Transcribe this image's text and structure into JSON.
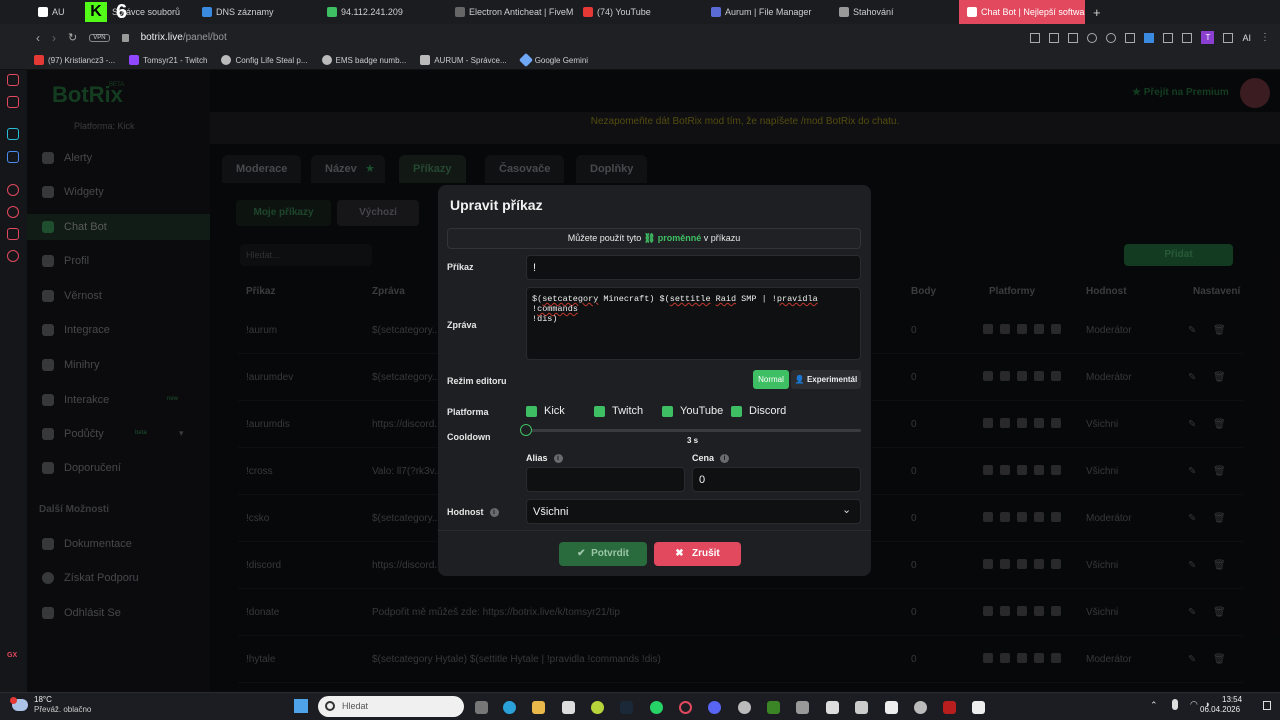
{
  "browser": {
    "tabs": [
      {
        "label": "AU",
        "color": "#e2495e"
      },
      {
        "label": "Správce souborů",
        "color": "#888"
      },
      {
        "label": "DNS záznamy",
        "color": "#3a8be0"
      },
      {
        "label": "94.112.241.209",
        "color": "#3fbf63"
      },
      {
        "label": "Electron Anticheat | FiveM",
        "color": "#666"
      },
      {
        "label": "(74) YouTube",
        "color": "#e53935"
      },
      {
        "label": "Aurum | File Manager",
        "color": "#5b6bd6"
      },
      {
        "label": "Stahování",
        "color": "#999"
      },
      {
        "label": "Chat Bot | Nejlepší software",
        "color": "#fff"
      }
    ],
    "new_tab": "+",
    "vpn": "VPN",
    "url_host": "botrix.live",
    "url_path": "/panel/bot",
    "ai_label": "AI",
    "profile_initial": "T",
    "bookmarks": [
      "(97) Kristiancz3 -...",
      "Tomsyr21 - Twitch",
      "Config Life Steal p...",
      "EMS badge numb...",
      "AURUM - Správce...",
      "Google Gemini"
    ]
  },
  "overlay": {
    "digit": "6"
  },
  "botrix": {
    "logo": "BotRix",
    "logo_badge": "BETA",
    "platform_label": "Platforma: Kick",
    "premium": "Přejít na Premium",
    "notice": "Nezapomeňte dát BotRix mod tím, že napíšete /mod BotRix do chatu.",
    "nav": [
      "Alerty",
      "Widgety",
      "Chat Bot",
      "Profil",
      "Věrnost",
      "Integrace",
      "Minihry",
      "Interakce",
      "Podůčty"
    ],
    "nav_interakce_badge": "new",
    "nav_podúčty_badge": "beta",
    "more_section": "Další Možnosti",
    "more_items": [
      "Dokumentace",
      "Získat Podporu",
      "Odhlásit Se"
    ],
    "tabs": [
      "Moderace",
      "Název",
      "Příkazy",
      "Časovače",
      "Doplňky"
    ],
    "subtabs": [
      "Moje příkazy",
      "Výchozí"
    ],
    "search_placeholder": "Hledat...",
    "add_button": "Přidat",
    "columns": [
      "Příkaz",
      "Zpráva",
      "Body",
      "Platformy",
      "Hodnost",
      "Nastavení"
    ],
    "rows": [
      {
        "cmd": "!aurum",
        "msg": "$(setcategory...",
        "points": "0",
        "rank": "Moderátor"
      },
      {
        "cmd": "!aurumdev",
        "msg": "$(setcategory...",
        "points": "0",
        "rank": "Moderátor"
      },
      {
        "cmd": "!aurumdis",
        "msg": "https://discord...",
        "points": "0",
        "rank": "Všichni"
      },
      {
        "cmd": "!cross",
        "msg": "Valo: ll7(?rk3v...",
        "points": "0",
        "rank": "Všichni"
      },
      {
        "cmd": "!csko",
        "msg": "$(setcategory...",
        "points": "0",
        "rank": "Moderátor"
      },
      {
        "cmd": "!discord",
        "msg": "https://discord...",
        "points": "0",
        "rank": "Všichni"
      },
      {
        "cmd": "!donate",
        "msg": "Podpořit mě můžeš zde: https://botrix.live/k/tomsyr21/tip",
        "points": "0",
        "rank": "Všichni"
      },
      {
        "cmd": "!hytale",
        "msg": "$(setcategory Hytale) $(settitle Hytale | !pravidla !commands !dis)",
        "points": "0",
        "rank": "Moderátor"
      }
    ]
  },
  "modal": {
    "title": "Upravit příkaz",
    "info_prefix": "Můžete použít tyto",
    "info_link": "proměnné",
    "info_suffix": "v příkazu",
    "command_label": "Příkaz",
    "command_value": "!",
    "message_label": "Zpráva",
    "message_line1_a": "$(",
    "message_line1_b": "setcategory",
    "message_line1_c": " Minecraft) $(",
    "message_line1_d": "settitle",
    "message_line1_e": " ",
    "message_line1_f": "Raid",
    "message_line1_g": " SMP | !",
    "message_line1_h": "pravidla",
    "message_line1_i": " !",
    "message_line1_j": "commands",
    "message_line2": "!dis)",
    "editor_label": "Režim editoru",
    "editor_normal": "Normal",
    "editor_experimental": "Experimentál",
    "platform_label": "Platforma",
    "platforms": [
      "Kick",
      "Twitch",
      "YouTube",
      "Discord"
    ],
    "cooldown_label": "Cooldown",
    "cooldown_value": "3 s",
    "cooldown_fraction": 0.0,
    "alias_label": "Alias",
    "price_label": "Cena",
    "price_value": "0",
    "rank_label": "Hodnost",
    "rank_value": "Všichni",
    "confirm": "Potvrdit",
    "cancel": "Zrušit"
  },
  "taskbar": {
    "weather_temp": "18°C",
    "weather_desc": "Převáž. oblačno",
    "search_placeholder": "Hledat",
    "time": "13:54",
    "date": "06.04.2026"
  },
  "os_side": {
    "gx": "GX"
  }
}
